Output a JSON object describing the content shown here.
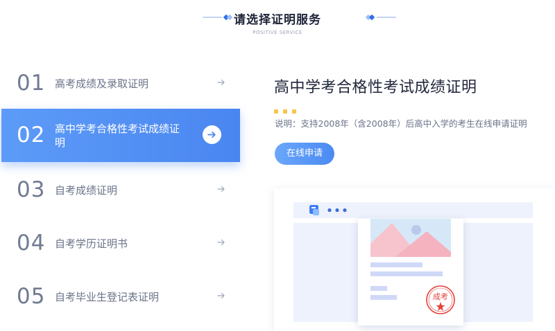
{
  "header": {
    "title": "请选择证明服务",
    "subtitle": "POSITIVE SERVICE"
  },
  "menu": {
    "items": [
      {
        "num": "01",
        "label": "高考成绩及录取证明",
        "active": false
      },
      {
        "num": "02",
        "label": "高中学考合格性考试成绩证明",
        "active": true
      },
      {
        "num": "03",
        "label": "自考成绩证明",
        "active": false
      },
      {
        "num": "04",
        "label": "自考学历证明书",
        "active": false
      },
      {
        "num": "05",
        "label": "自考毕业生登记表证明",
        "active": false
      }
    ]
  },
  "detail": {
    "title": "高中学考合格性考试成绩证明",
    "description": "说明：支持2008年（含2008年）后高中入学的考生在线申请证明",
    "apply_label": "在线申请"
  },
  "illustration": {
    "seal_text": "成考"
  },
  "colors": {
    "accent": "#4a86f0",
    "dot_yellow": "#f7c44c",
    "seal_red": "#e4403a"
  },
  "icons": {
    "arrow": "arrow-right-icon",
    "seal": "seal-stamp-icon",
    "app": "app-logo-icon"
  }
}
